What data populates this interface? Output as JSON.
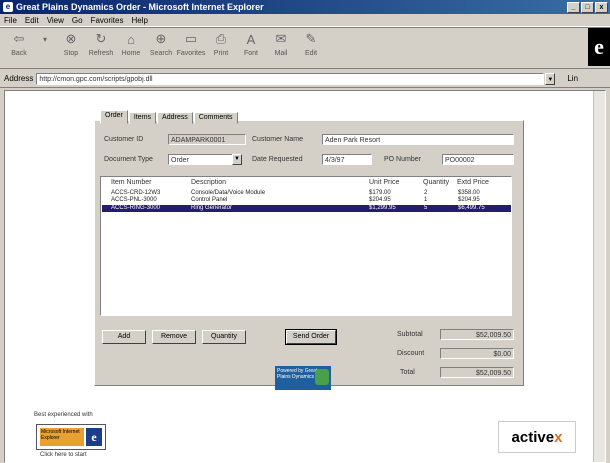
{
  "window": {
    "title": "Great Plains Dynamics Order - Microsoft Internet Explorer",
    "menu": [
      "File",
      "Edit",
      "View",
      "Go",
      "Favorites",
      "Help"
    ]
  },
  "toolbar": {
    "buttons": [
      {
        "label": "Back",
        "icon": "back-arrow"
      },
      {
        "label": "",
        "icon": "forward-arrow"
      },
      {
        "label": "Stop",
        "icon": "stop"
      },
      {
        "label": "Refresh",
        "icon": "refresh"
      },
      {
        "label": "Home",
        "icon": "home"
      },
      {
        "label": "Search",
        "icon": "search"
      },
      {
        "label": "Favorites",
        "icon": "favorites"
      },
      {
        "label": "Print",
        "icon": "print"
      },
      {
        "label": "Font",
        "icon": "font"
      },
      {
        "label": "Mail",
        "icon": "mail"
      },
      {
        "label": "Edit",
        "icon": "edit"
      }
    ]
  },
  "address": {
    "label": "Address",
    "value": "http://cmon.gpc.com/scripts/gpobj.dll",
    "links_label": "Lin"
  },
  "tabs": [
    "Order",
    "Items",
    "Address",
    "Comments"
  ],
  "form": {
    "customer_id_label": "Customer ID",
    "customer_id_value": "ADAMPARK0001",
    "customer_name_label": "Customer Name",
    "customer_name_value": "Aden Park Resort",
    "doc_type_label": "Document Type",
    "doc_type_value": "Order",
    "date_req_label": "Date Requested",
    "date_req_value": "4/3/97",
    "po_label": "PO Number",
    "po_value": "PO00002"
  },
  "items_table": {
    "columns": [
      "Item Number",
      "Description",
      "Unit Price",
      "Quantity",
      "Extd Price"
    ],
    "rows": [
      {
        "item": "ACCS-CRD-12W3",
        "desc": "Console/Data/Voice Module",
        "price": "$179.00",
        "qty": "2",
        "extd": "$358.00",
        "selected": false
      },
      {
        "item": "ACCS-PNL-3000",
        "desc": "Control Panel",
        "price": "$204.95",
        "qty": "1",
        "extd": "$204.95",
        "selected": false
      },
      {
        "item": "ACCS-RING-3000",
        "desc": "Ring Generator",
        "price": "$1,299.95",
        "qty": "5",
        "extd": "$6,499.75",
        "selected": true
      }
    ]
  },
  "buttons": {
    "add": "Add",
    "remove": "Remove",
    "quantity": "Quantity",
    "send": "Send Order"
  },
  "totals": {
    "subtotal_label": "Subtotal",
    "subtotal_value": "$52,009.50",
    "discount_label": "Discount",
    "discount_value": "$0.00",
    "total_label": "Total",
    "total_value": "$52,009.50"
  },
  "footer": {
    "gp_logo_text": "Powered by Great Plains Dynamics",
    "ie_prompt": "Best experienced with",
    "ie_badge_text": "Microsoft Internet Explorer",
    "ie_click": "Click here to start",
    "active_logo_text": "active",
    "active_logo_mark": "x"
  }
}
